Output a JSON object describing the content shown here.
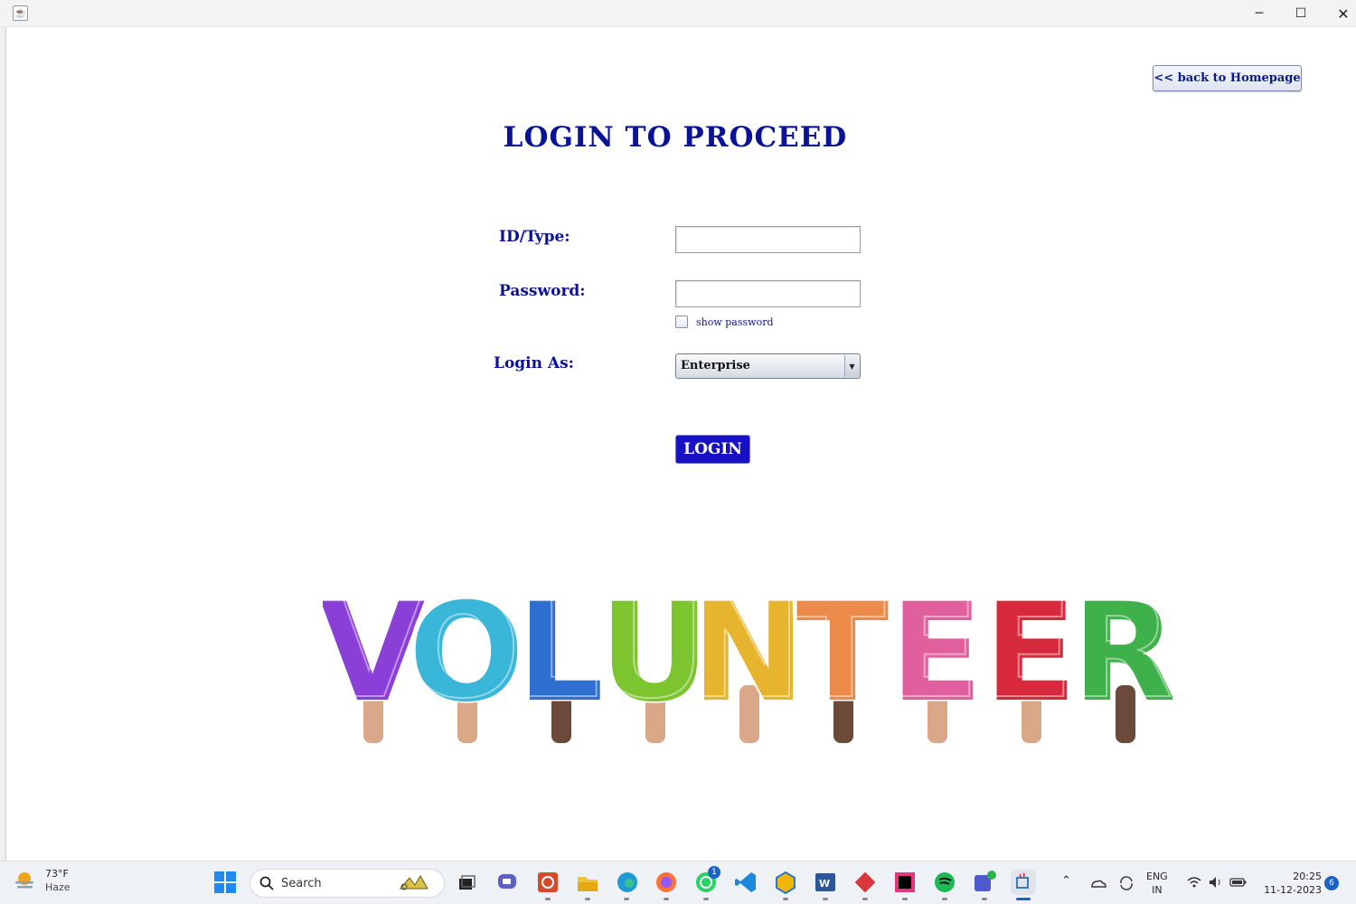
{
  "window": {
    "min_glyph": "─",
    "max_glyph": "☐",
    "close_glyph": "✕"
  },
  "header": {
    "back_button": "<< back to Homepage",
    "title": "LOGIN TO PROCEED"
  },
  "form": {
    "id_label": "ID/Type:",
    "id_value": "",
    "password_label": "Password:",
    "password_value": "",
    "show_password_label": "show password",
    "show_password_checked": false,
    "login_as_label": "Login As:",
    "login_as_value": "Enterprise",
    "login_button": "LOGIN"
  },
  "banner": {
    "letters": [
      "V",
      "O",
      "L",
      "U",
      "N",
      "T",
      "E",
      "E",
      "R"
    ],
    "colors": [
      "#8a3fd6",
      "#3ab6d8",
      "#2f6fd0",
      "#7cc52e",
      "#e7b52d",
      "#ec8a4a",
      "#e0609d",
      "#d62a3c",
      "#3fb14a"
    ]
  },
  "taskbar": {
    "weather_temp": "73°F",
    "weather_condition": "Haze",
    "search_placeholder": "Search",
    "whatsapp_badge": "1",
    "lang": "ENG",
    "region": "IN",
    "time": "20:25",
    "date": "11-12-2023",
    "notification_count": "6",
    "icons": [
      "start-icon",
      "search-icon",
      "file-explorer-icon",
      "chat-icon",
      "app-icon",
      "folder-icon",
      "edge-icon",
      "firefox-icon",
      "whatsapp-icon",
      "vscode-icon",
      "app-hex-icon",
      "word-icon",
      "git-icon",
      "intellij-icon",
      "spotify-icon",
      "teams-icon",
      "java-icon"
    ]
  }
}
